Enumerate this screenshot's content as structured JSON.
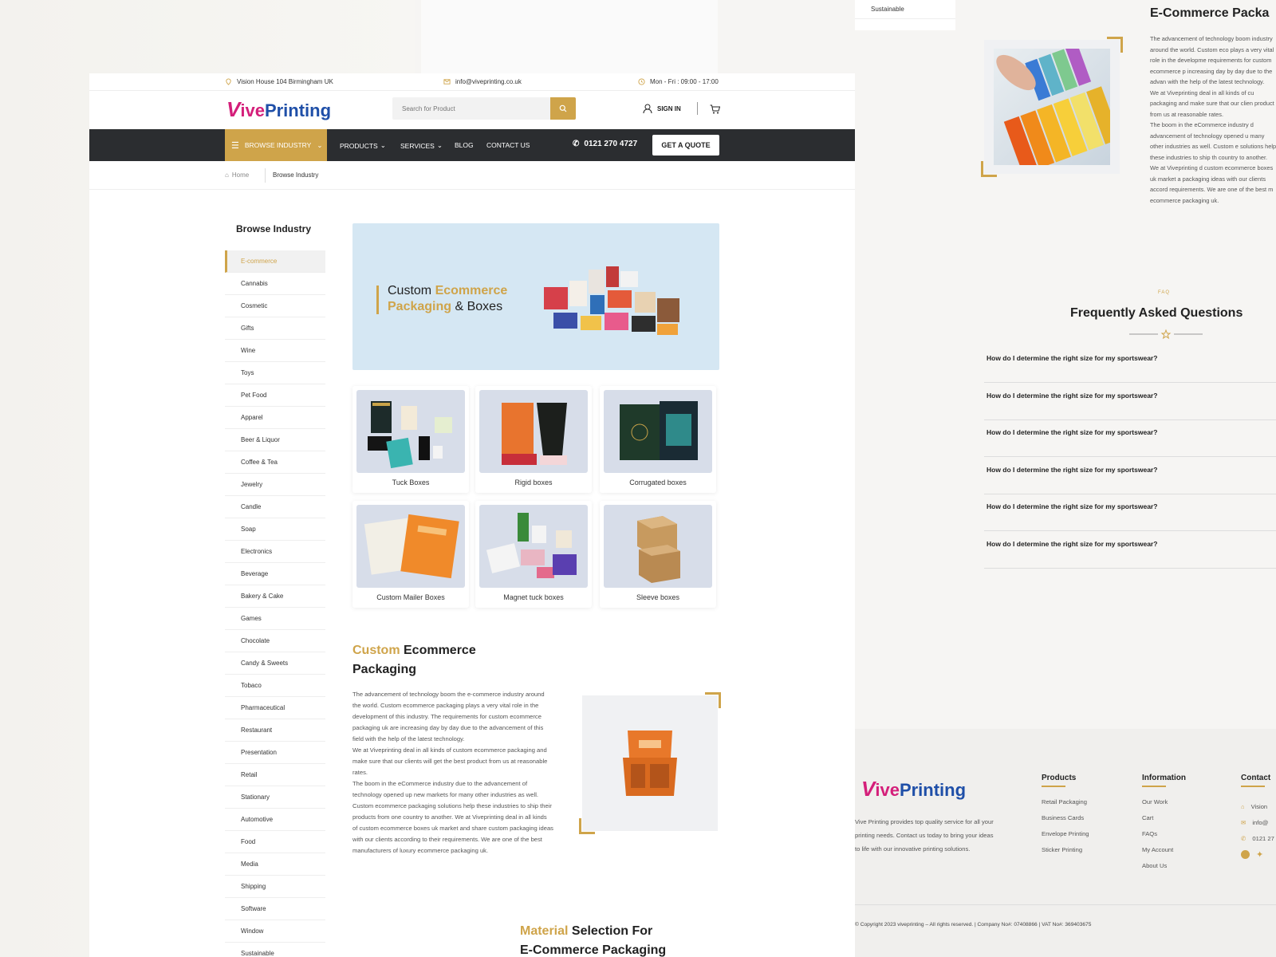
{
  "colors": {
    "accent": "#cfa44a",
    "nav_bg": "#2b2d30",
    "banner_bg": "#d5e7f3"
  },
  "topbar": {
    "address": "Vision House 104  Birmingham UK",
    "email": "info@viveprinting.co.uk",
    "hours": "Mon - Fri : 09:00 - 17:00"
  },
  "header": {
    "logo_v": "V",
    "logo_ive": "ive",
    "logo_printing": "Printing",
    "search_placeholder": "Search for Product",
    "signin_label": "SIGN IN"
  },
  "nav": {
    "browse_label": "BROWSE INDUSTRY",
    "products": "PRODUCTS",
    "services": "SERVICES",
    "blog": "BLOG",
    "contact": "CONTACT US",
    "phone": "0121 270 4727",
    "quote": "GET A QUOTE"
  },
  "breadcrumb": {
    "home": "Home",
    "current": "Browse Industry"
  },
  "sidebar": {
    "title": "Browse Industry",
    "items": [
      "E-commerce",
      "Cannabis",
      "Cosmetic",
      "Gifts",
      "Wine",
      "Toys",
      "Pet Food",
      "Apparel",
      "Beer & Liquor",
      "Coffee & Tea",
      "Jewelry",
      "Candle",
      "Soap",
      "Electronics",
      "Beverage",
      "Bakery & Cake",
      "Games",
      "Chocolate",
      "Candy & Sweets",
      "Tobaco",
      "Pharmaceutical",
      "Restaurant",
      "Presentation",
      "Retail",
      "Stationary",
      "Automotive",
      "Food",
      "Media",
      "Shipping",
      "Software",
      "Window",
      "Sustainable"
    ]
  },
  "banner": {
    "line1_a": "Custom ",
    "line1_b": "Ecommerce",
    "line2_a": "Packaging",
    "line2_b": " & Boxes"
  },
  "products": [
    {
      "label": "Tuck Boxes"
    },
    {
      "label": "Rigid boxes"
    },
    {
      "label": "Corrugated boxes"
    },
    {
      "label": "Custom Mailer Boxes"
    },
    {
      "label": "Magnet tuck boxes"
    },
    {
      "label": "Sleeve boxes"
    }
  ],
  "section": {
    "title_a": "Custom",
    "title_b": " Ecommerce",
    "title_c": "Packaging",
    "p1": "The advancement of technology boom the e-commerce industry around the world. Custom ecommerce packaging plays a very vital role in the development of this industry. The requirements for custom ecommerce packaging uk are increasing day by day due to the advancement of this field with the help of the latest technology.",
    "p2": "We at Viveprinting deal in all kinds of custom ecommerce packaging and make sure that our clients will get the best product from us at reasonable rates.",
    "p3": "The boom in the eCommerce industry due to the advancement of technology opened up new markets for many other industries as well. Custom ecommerce packaging solutions help these industries to ship their products from one country to another. We at Viveprinting deal in all kinds of custom ecommerce boxes uk market and share custom packaging ideas with our clients according to their requirements. We are one of the best manufacturers of luxury ecommerce packaging uk."
  },
  "material": {
    "title_a": "Material",
    "title_b": " Selection For",
    "title_c": "E-Commerce Packaging"
  },
  "right": {
    "side_fragment": "Sustainable",
    "ec_title": "E-Commerce Packa",
    "ec_p1": "The advancement of technology boom industry around the world. Custom eco plays a very vital role in the developme requirements for custom ecommerce p increasing day by day due to the advan with the help of the latest technology.",
    "ec_p2": "We at Viveprinting deal in all kinds of cu packaging and make sure that our clien product from us at reasonable rates.",
    "ec_p3": "The boom in the eCommerce industry d advancement of technology opened u many other industries as well. Custom e solutions help these industries to ship th country to another. We at Viveprinting d custom ecommerce boxes uk market a packaging ideas with our clients accord requirements. We are one of the best m ecommerce packaging uk."
  },
  "faq": {
    "small": "FAQ",
    "title": "Frequently Asked Questions",
    "items": [
      "How do I determine the right size for my sportswear?",
      "How do I determine the right size for my sportswear?",
      "How do I determine the right size for my sportswear?",
      "How do I determine the right size for my sportswear?",
      "How do I determine the right size for my sportswear?",
      "How do I determine the right size for my sportswear?"
    ]
  },
  "footer": {
    "desc": "Vive Printing provides top quality service for all your printing needs. Contact us today to bring your ideas to life with our innovative printing solutions.",
    "products_title": "Products",
    "products": [
      "Retail Packaging",
      "Business Cards",
      "Envelope Printing",
      "Sticker Printing"
    ],
    "info_title": "Information",
    "info": [
      "Our Work",
      "Cart",
      "FAQs",
      "My Account",
      "About Us"
    ],
    "contact_title": "Contact",
    "contact": [
      "Vision",
      "info@",
      "0121 27"
    ],
    "copyright": "© Copyright 2023 viveprinting – All rights reserved. | Company No#: 07408866 | VAT No#: 369403675"
  }
}
